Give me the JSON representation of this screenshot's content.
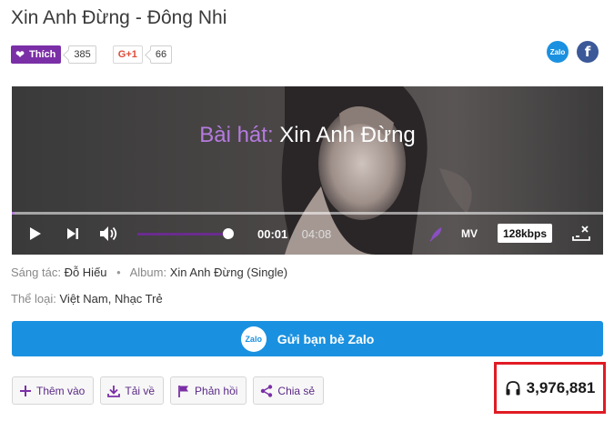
{
  "header": {
    "song_title": "Xin Anh Đừng",
    "separator": "-",
    "artist": "Đông Nhi"
  },
  "social": {
    "like_label": "Thích",
    "like_count": "385",
    "gplus_label": "G+1",
    "gplus_count": "66",
    "zalo_icon_label": "Zalo",
    "facebook_icon_label": "f"
  },
  "player": {
    "caption_prefix": "Bài hát:",
    "caption_title": "Xin Anh Đừng",
    "current_time": "00:01",
    "time_divider": "|",
    "duration": "04:08",
    "mv_label": "MV",
    "bitrate_label": "128kbps",
    "progress_fraction": 0.004,
    "volume_fraction": 0.95
  },
  "meta": {
    "composer_label": "Sáng tác:",
    "composer": "Đỗ Hiếu",
    "dot": "•",
    "album_label": "Album:",
    "album": "Xin Anh Đừng (Single)",
    "genre_label": "Thể loại:",
    "genre": "Việt Nam, Nhạc Trẻ"
  },
  "zalo_share": {
    "icon_label": "Zalo",
    "label": "Gửi bạn bè Zalo"
  },
  "actions": [
    {
      "label": "Thêm vào",
      "icon": "plus-icon"
    },
    {
      "label": "Tải về",
      "icon": "download-icon"
    },
    {
      "label": "Phản hồi",
      "icon": "flag-icon"
    },
    {
      "label": "Chia sẻ",
      "icon": "share-icon"
    }
  ],
  "listens": {
    "count": "3,976,881",
    "icon": "headphones-icon"
  },
  "colors": {
    "brand_purple": "#7b2fa6",
    "zalo_blue": "#1a91e0",
    "facebook_blue": "#3b5998",
    "highlight_red": "#e01b24"
  }
}
